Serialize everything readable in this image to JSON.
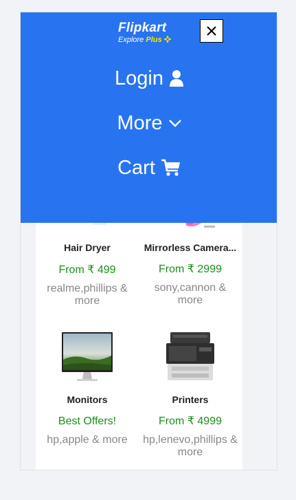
{
  "logo": {
    "brand": "Flipkart",
    "sub_explore": "Explore",
    "sub_plus": "Plus"
  },
  "menu": {
    "login_label": "Login",
    "more_label": "More",
    "cart_label": "Cart",
    "close_label": "×"
  },
  "colors": {
    "accent": "#2874f0",
    "price": "#1a8e1a",
    "muted": "#878787",
    "plus": "#ffe500"
  },
  "products": [
    {
      "name": "Hair Dryer",
      "price": "From ₹ 499",
      "brands": "realme,phillips & more",
      "icon": "hair-dryer-image"
    },
    {
      "name": "Mirrorless Camera...",
      "price": "From ₹ 2999",
      "brands": "sony,cannon & more",
      "icon": "camera-image"
    },
    {
      "name": "Monitors",
      "price": "Best Offers!",
      "brands": "hp,apple & more",
      "icon": "monitor-image"
    },
    {
      "name": "Printers",
      "price": "From ₹ 4999",
      "brands": "hp,lenevo,phillips & more",
      "icon": "printer-image"
    }
  ]
}
